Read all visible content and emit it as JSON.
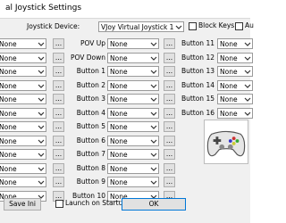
{
  "window": {
    "title": "al Joystick Settings"
  },
  "device": {
    "label": "Joystick Device:",
    "value": "VJoy Virtual Joystick 1"
  },
  "options": {
    "block_keys_label": "Block Keys",
    "au_label": "Au",
    "launch_label": "Launch on Startup"
  },
  "left_rows": [
    "None",
    "None",
    "None",
    "None",
    "None",
    "None",
    "None",
    "None",
    "None",
    "None",
    "None",
    "None"
  ],
  "mid_rows": [
    {
      "label": "POV Up",
      "value": "None"
    },
    {
      "label": "POV Down",
      "value": "None"
    },
    {
      "label": "Button 1",
      "value": "None"
    },
    {
      "label": "Button 2",
      "value": "None"
    },
    {
      "label": "Button 3",
      "value": "None"
    },
    {
      "label": "Button 4",
      "value": "None"
    },
    {
      "label": "Button 5",
      "value": "None"
    },
    {
      "label": "Button 6",
      "value": "None"
    },
    {
      "label": "Button 7",
      "value": "None"
    },
    {
      "label": "Button 8",
      "value": "None"
    },
    {
      "label": "Button 9",
      "value": "None"
    },
    {
      "label": "Button 10",
      "value": "None"
    }
  ],
  "right_rows": [
    {
      "label": "Button 11",
      "value": "None"
    },
    {
      "label": "Button 12",
      "value": "None"
    },
    {
      "label": "Button 13",
      "value": "None"
    },
    {
      "label": "Button 14",
      "value": "None"
    },
    {
      "label": "Button 15",
      "value": "None"
    },
    {
      "label": "Button 16",
      "value": "None"
    }
  ],
  "buttons": {
    "save": "Save Ini",
    "ok": "OK",
    "ellipsis": "..."
  },
  "icons": {
    "dropdown": "chevron-down-icon",
    "gamepad": "gamepad-icon"
  }
}
